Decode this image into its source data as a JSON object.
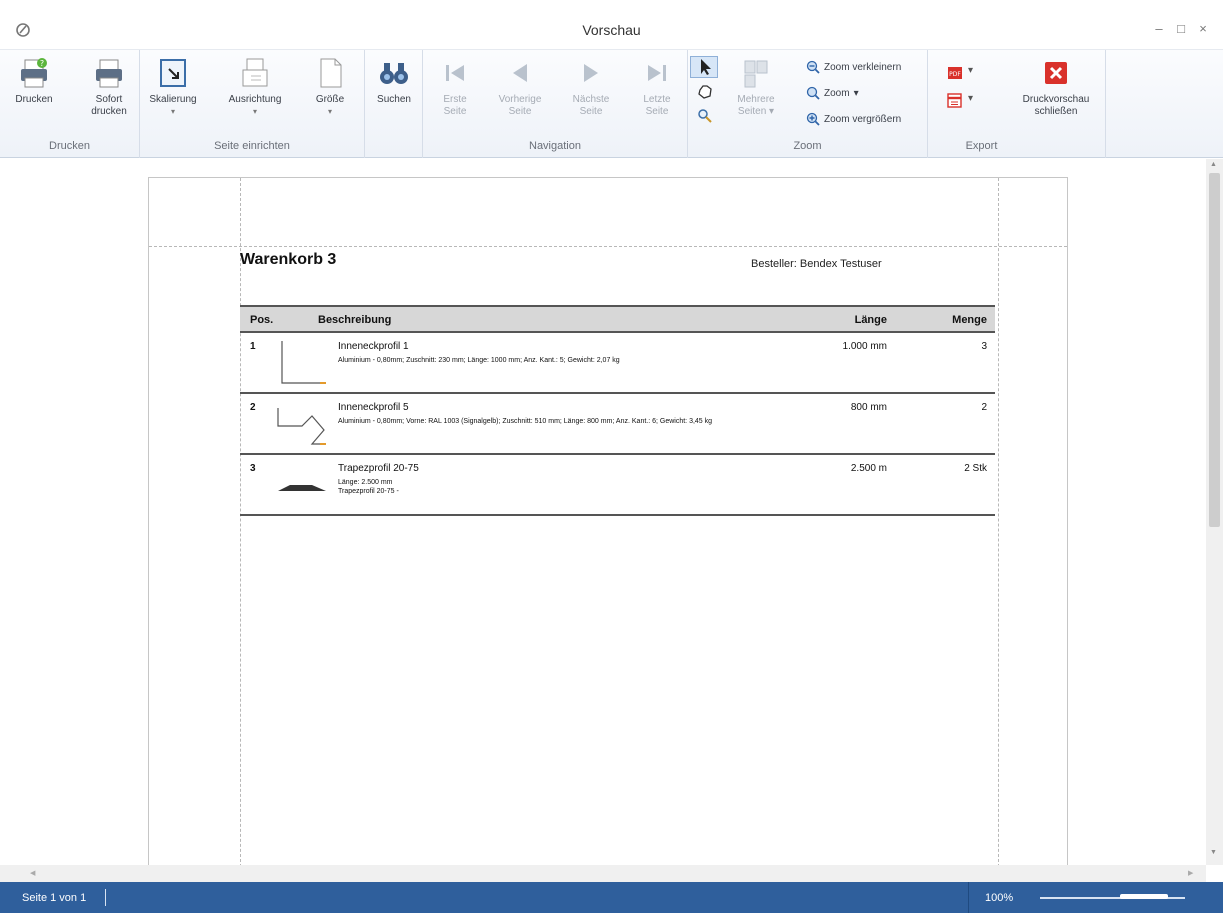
{
  "window": {
    "title": "Vorschau",
    "minimize": "–",
    "maximize": "□",
    "close": "×"
  },
  "ribbon": {
    "print_group": {
      "label": "Drucken",
      "print": "Drucken",
      "quick_print_line1": "Sofort",
      "quick_print_line2": "drucken"
    },
    "page_setup_group": {
      "label": "Seite einrichten",
      "scaling": "Skalierung",
      "orientation": "Ausrichtung",
      "size": "Größe"
    },
    "search": {
      "label": "Suchen"
    },
    "navigation_group": {
      "label": "Navigation",
      "first_line1": "Erste",
      "first_line2": "Seite",
      "prev_line1": "Vorherige",
      "prev_line2": "Seite",
      "next_line1": "Nächste",
      "next_line2": "Seite",
      "last_line1": "Letzte",
      "last_line2": "Seite"
    },
    "zoom_group": {
      "label": "Zoom",
      "multiple_line1": "Mehrere",
      "multiple_line2": "Seiten",
      "zoom_out": "Zoom verkleinern",
      "zoom": "Zoom",
      "zoom_in": "Zoom vergrößern"
    },
    "export_group": {
      "label": "Export"
    },
    "close_preview_line1": "Druckvorschau",
    "close_preview_line2": "schließen"
  },
  "document": {
    "title": "Warenkorb 3",
    "orderer": "Besteller: Bendex Testuser",
    "columns": {
      "pos": "Pos.",
      "desc": "Beschreibung",
      "length": "Länge",
      "qty": "Menge"
    },
    "rows": [
      {
        "pos": "1",
        "name": "Inneneckprofil 1",
        "desc": "Aluminium - 0,80mm; Zuschnitt: 230 mm; Länge: 1000 mm; Anz. Kant.: 5; Gewicht: 2,07 kg",
        "length": "1.000 mm",
        "qty": "3"
      },
      {
        "pos": "2",
        "name": "Inneneckprofil 5",
        "desc": "Aluminium - 0,80mm; Vorne: RAL 1003 (Signalgelb); Zuschnitt: 510 mm; Länge: 800 mm; Anz. Kant.: 6; Gewicht: 3,45 kg",
        "length": "800 mm",
        "qty": "2"
      },
      {
        "pos": "3",
        "name": "Trapezprofil 20-75",
        "desc_line1": "Länge: 2.500 mm",
        "desc_line2": "Trapezprofil 20-75 -",
        "length": "2.500 m",
        "qty": "2 Stk"
      }
    ]
  },
  "status": {
    "page_info": "Seite 1 von 1",
    "zoom": "100%"
  },
  "colors": {
    "statusbar": "#2f5f9c",
    "accent": "#3a6fb0",
    "close_red": "#d9312b"
  },
  "icons": [
    "printer-icon",
    "quick-print-icon",
    "scaling-icon",
    "orientation-icon",
    "page-size-icon",
    "binoculars-icon",
    "first-page-icon",
    "prev-page-icon",
    "next-page-icon",
    "last-page-icon",
    "pointer-icon",
    "hand-icon",
    "magnifier-icon",
    "multiple-pages-icon",
    "zoom-out-icon",
    "zoom-icon",
    "zoom-in-icon",
    "pdf-export-icon",
    "image-export-icon",
    "close-preview-icon"
  ]
}
